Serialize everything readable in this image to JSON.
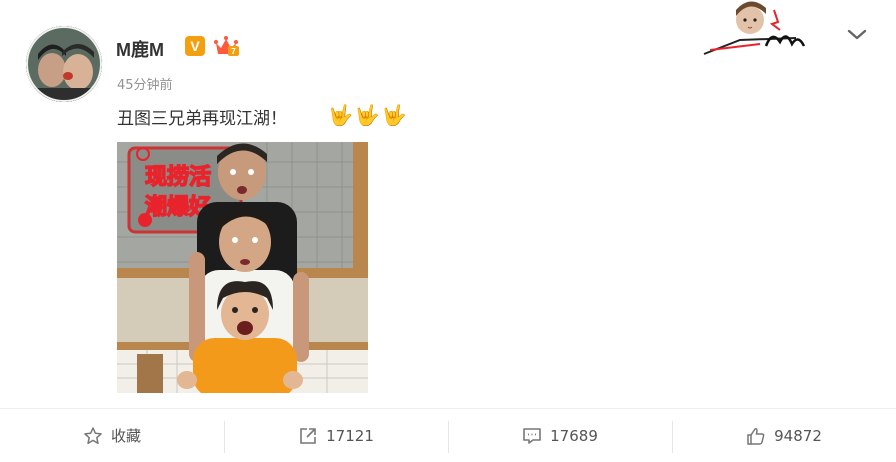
{
  "author": {
    "name": "M鹿M",
    "verified_badge": "V",
    "time": "45分钟前"
  },
  "post": {
    "text": "丑图三兄弟再现江湖！",
    "emojis": [
      "🤟",
      "🤟",
      "🤟"
    ]
  },
  "photo": {
    "sign_line1": "现捞活",
    "sign_line2": "潮爆好"
  },
  "actions": {
    "favorite_label": "收藏",
    "repost_count": "17121",
    "comment_count": "17689",
    "like_count": "94872"
  },
  "colors": {
    "verified": "#f2a010",
    "accent_red": "#e8232b",
    "shirt_orange": "#f39a1b"
  }
}
